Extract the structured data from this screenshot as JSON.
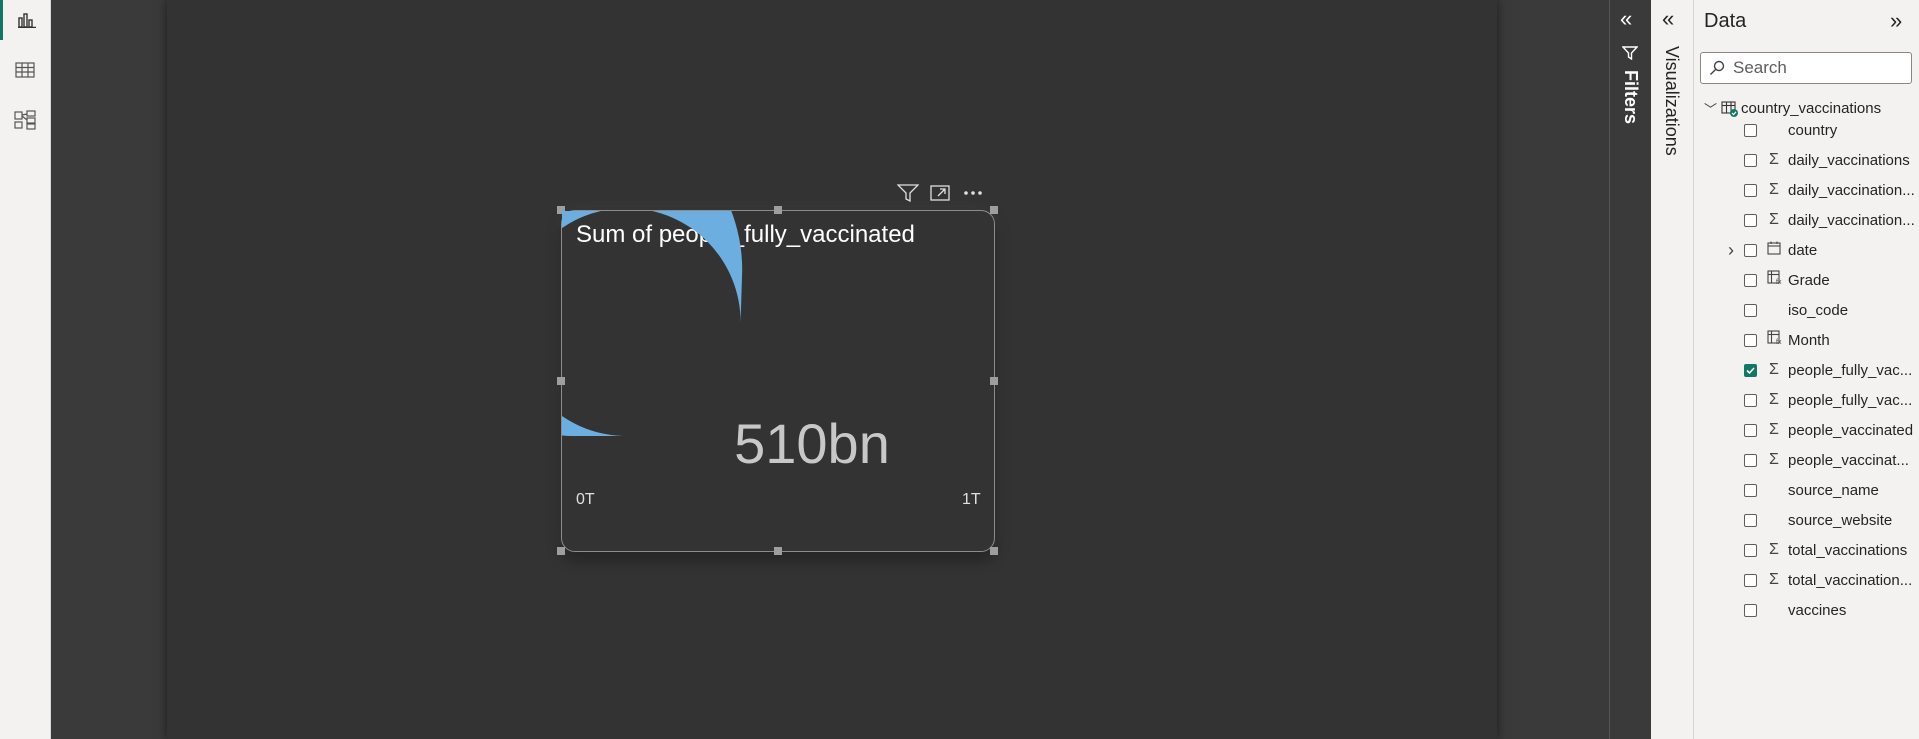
{
  "left_rail": {
    "items": [
      {
        "name": "report-view",
        "icon": "bar-chart-icon"
      },
      {
        "name": "table-view",
        "icon": "table-icon"
      },
      {
        "name": "model-view",
        "icon": "model-icon"
      }
    ]
  },
  "visual": {
    "title": "Sum of people_fully_vaccinated",
    "value_label": "510bn",
    "min_label": "0T",
    "max_label": "1T",
    "fill_color": "#6CAEE0",
    "header_icons": [
      "filter-icon",
      "focus-mode-icon",
      "more-options-icon"
    ]
  },
  "chart_data": {
    "type": "gauge",
    "title": "Sum of people_fully_vaccinated",
    "value": 0.51,
    "min": 0,
    "max": 1,
    "display_value": "510bn",
    "min_label": "0T",
    "max_label": "1T"
  },
  "panes": {
    "filters_label": "Filters",
    "visualizations_label": "Visualizations"
  },
  "data_pane": {
    "title": "Data",
    "search_placeholder": "Search",
    "table": "country_vaccinations",
    "fields": [
      {
        "name": "country",
        "icon": "",
        "checked": false,
        "expandable": false
      },
      {
        "name": "daily_vaccinations",
        "icon": "Σ",
        "checked": false,
        "expandable": false
      },
      {
        "name": "daily_vaccination...",
        "icon": "Σ",
        "checked": false,
        "expandable": false
      },
      {
        "name": "daily_vaccination...",
        "icon": "Σ",
        "checked": false,
        "expandable": false
      },
      {
        "name": "date",
        "icon": "calendar",
        "checked": false,
        "expandable": true
      },
      {
        "name": "Grade",
        "icon": "calc",
        "checked": false,
        "expandable": false
      },
      {
        "name": "iso_code",
        "icon": "",
        "checked": false,
        "expandable": false
      },
      {
        "name": "Month",
        "icon": "calc",
        "checked": false,
        "expandable": false
      },
      {
        "name": "people_fully_vac...",
        "icon": "Σ",
        "checked": true,
        "expandable": false
      },
      {
        "name": "people_fully_vac...",
        "icon": "Σ",
        "checked": false,
        "expandable": false
      },
      {
        "name": "people_vaccinated",
        "icon": "Σ",
        "checked": false,
        "expandable": false
      },
      {
        "name": "people_vaccinat...",
        "icon": "Σ",
        "checked": false,
        "expandable": false
      },
      {
        "name": "source_name",
        "icon": "",
        "checked": false,
        "expandable": false
      },
      {
        "name": "source_website",
        "icon": "",
        "checked": false,
        "expandable": false
      },
      {
        "name": "total_vaccinations",
        "icon": "Σ",
        "checked": false,
        "expandable": false
      },
      {
        "name": "total_vaccination...",
        "icon": "Σ",
        "checked": false,
        "expandable": false
      },
      {
        "name": "vaccines",
        "icon": "",
        "checked": false,
        "expandable": false
      }
    ]
  }
}
